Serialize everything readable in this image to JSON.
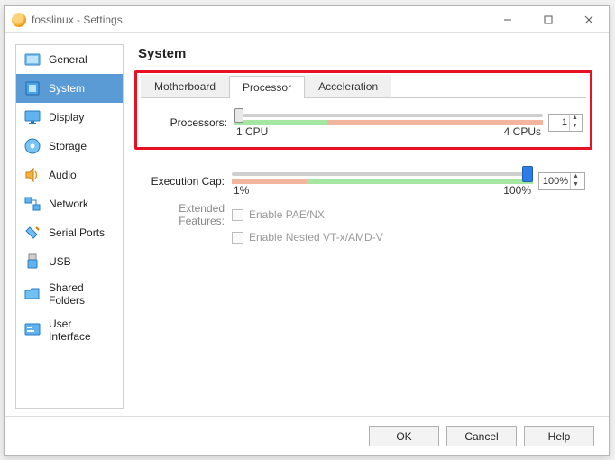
{
  "window": {
    "title": "fosslinux - Settings"
  },
  "sidebar": {
    "items": [
      {
        "label": "General"
      },
      {
        "label": "System"
      },
      {
        "label": "Display"
      },
      {
        "label": "Storage"
      },
      {
        "label": "Audio"
      },
      {
        "label": "Network"
      },
      {
        "label": "Serial Ports"
      },
      {
        "label": "USB"
      },
      {
        "label": "Shared Folders"
      },
      {
        "label": "User Interface"
      }
    ],
    "selected": 1
  },
  "main": {
    "heading": "System",
    "tabs": [
      {
        "label": "Motherboard"
      },
      {
        "label": "Processor"
      },
      {
        "label": "Acceleration"
      }
    ],
    "active_tab": 1,
    "processors": {
      "label": "Processors:",
      "value": "1",
      "min_label": "1 CPU",
      "max_label": "4 CPUs"
    },
    "execution_cap": {
      "label": "Execution Cap:",
      "value": "100%",
      "min_label": "1%",
      "max_label": "100%"
    },
    "extended": {
      "label": "Extended Features:",
      "pae": "Enable PAE/NX",
      "nested": "Enable Nested VT-x/AMD-V"
    }
  },
  "footer": {
    "ok": "OK",
    "cancel": "Cancel",
    "help": "Help"
  }
}
